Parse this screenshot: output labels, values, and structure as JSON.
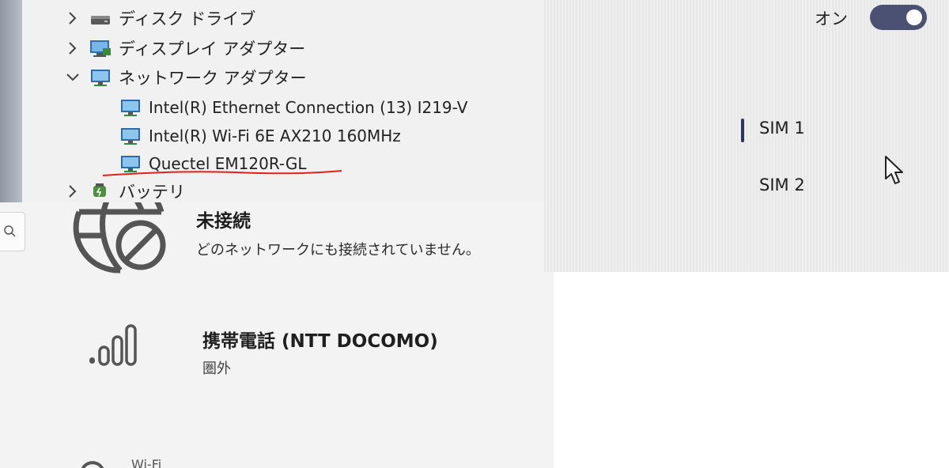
{
  "device_manager": {
    "categories": [
      {
        "label": "ディスク ドライブ",
        "expanded": false,
        "icon": "disk-drive-icon"
      },
      {
        "label": "ディスプレイ アダプター",
        "expanded": false,
        "icon": "display-adapter-icon"
      },
      {
        "label": "ネットワーク アダプター",
        "expanded": true,
        "icon": "network-adapter-icon"
      },
      {
        "label": "バッテリ",
        "expanded": false,
        "icon": "battery-icon"
      }
    ],
    "network_adapters": [
      {
        "label": "Intel(R) Ethernet Connection (13) I219-V",
        "icon": "network-adapter-icon"
      },
      {
        "label": "Intel(R) Wi-Fi 6E AX210 160MHz",
        "icon": "network-adapter-icon"
      },
      {
        "label": "Quectel EM120R-GL",
        "icon": "network-adapter-icon",
        "highlighted": true
      }
    ],
    "highlight_color": "#e0201b"
  },
  "network_status": {
    "title": "未接続",
    "description": "どのネットワークにも接続されていません。",
    "icon": "globe-no-connection-icon",
    "cellular": {
      "title": "携帯電話 (NTT DOCOMO)",
      "status": "圏外",
      "icon": "signal-bars-icon",
      "signal_level": 0
    },
    "wifi_fragment": "Wi-Fi"
  },
  "sim_settings": {
    "toggle_label": "オン",
    "toggle_on": true,
    "toggle_color": "#4a5172",
    "options": [
      "SIM 1",
      "SIM 2"
    ],
    "selected": "SIM 1"
  }
}
